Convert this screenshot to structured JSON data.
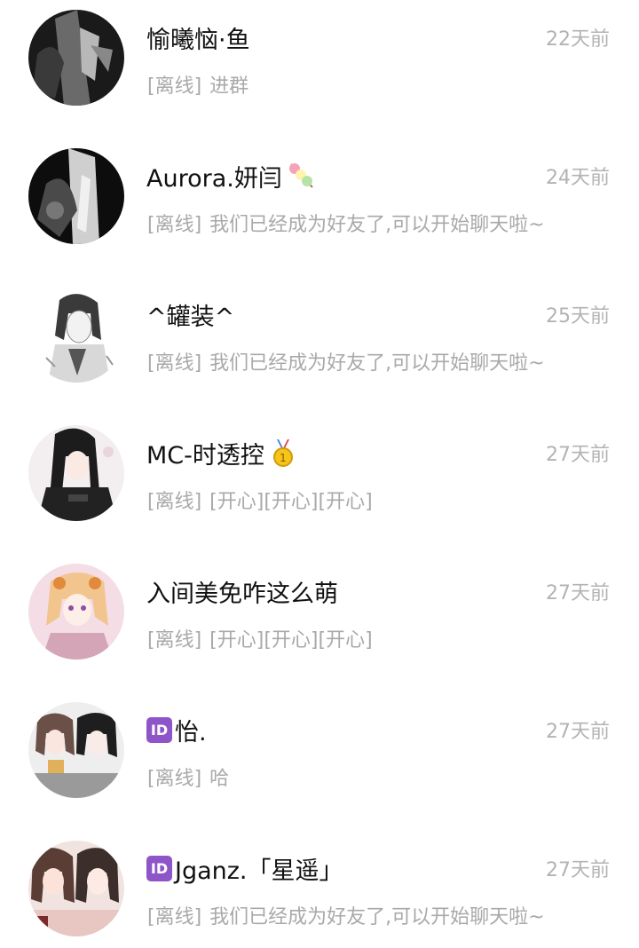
{
  "conversations": [
    {
      "name": "愉曦恼·鱼",
      "time": "22天前",
      "status": "[离线]",
      "message": "进群",
      "name_badge": "",
      "name_icon": "",
      "avatar": "dark-figure-avatar"
    },
    {
      "name": "Aurora.妍闫",
      "time": "24天前",
      "status": "[离线]",
      "message": "我们已经成为好友了,可以开始聊天啦~",
      "name_badge": "",
      "name_icon": "dango-emoji-icon",
      "avatar": "dark-figure-avatar"
    },
    {
      "name": "^罐装^",
      "time": "25天前",
      "status": "[离线]",
      "message": "我们已经成为好友了,可以开始聊天啦~",
      "name_badge": "",
      "name_icon": "",
      "avatar": "sketch-figure-avatar"
    },
    {
      "name": "MC-时透控",
      "time": "27天前",
      "status": "[离线]",
      "message": "[开心][开心][开心]",
      "name_badge": "",
      "name_icon": "gold-medal-icon",
      "avatar": "anime-boy-avatar"
    },
    {
      "name": "入间美免咋这么萌",
      "time": "27天前",
      "status": "[离线]",
      "message": "[开心][开心][开心]",
      "name_badge": "",
      "name_icon": "",
      "avatar": "anime-girl-avatar"
    },
    {
      "name": "怡.",
      "time": "27天前",
      "status": "[离线]",
      "message": "哈",
      "name_badge": "ID",
      "name_icon": "",
      "avatar": "two-girls-avatar"
    },
    {
      "name": "Jganz.「星遥」",
      "time": "27天前",
      "status": "[离线]",
      "message": "我们已经成为好友了,可以开始聊天啦~",
      "name_badge": "ID",
      "name_icon": "",
      "avatar": "photo-girls-avatar"
    }
  ],
  "colors": {
    "name": "#111111",
    "time": "#b3b3b3",
    "preview": "#a9a9a9",
    "id_badge": "#8e55c9"
  }
}
